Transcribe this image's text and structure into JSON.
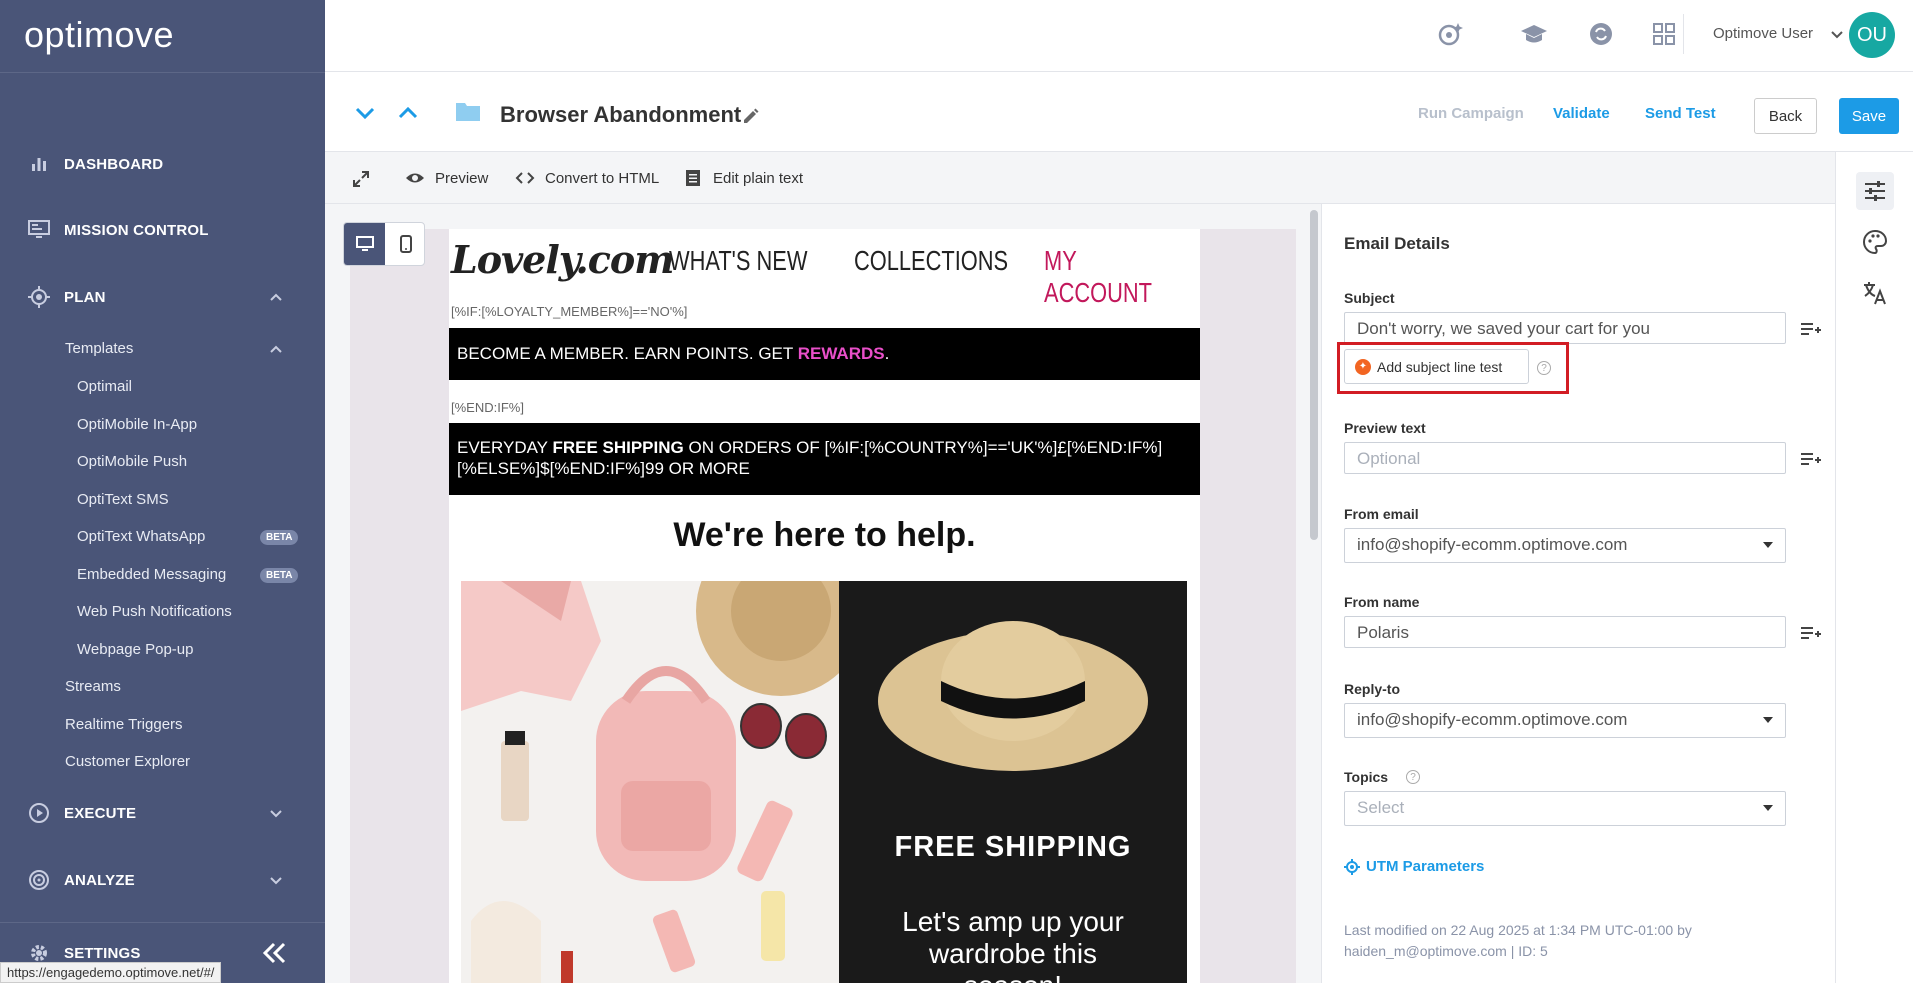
{
  "sidebar": {
    "logo": "optimove",
    "sections": {
      "dashboard": "DASHBOARD",
      "mission_control": "MISSION CONTROL",
      "plan": "PLAN",
      "execute": "EXECUTE",
      "analyze": "ANALYZE",
      "settings": "SETTINGS"
    },
    "plan_items": {
      "templates": "Templates",
      "optimail": "Optimail",
      "optimobile_inapp": "OptiMobile In-App",
      "optimobile_push": "OptiMobile Push",
      "optitext_sms": "OptiText SMS",
      "optitext_whatsapp": "OptiText WhatsApp",
      "embedded_messaging": "Embedded Messaging",
      "web_push": "Web Push Notifications",
      "webpage_popup": "Webpage Pop-up",
      "streams": "Streams",
      "realtime_triggers": "Realtime Triggers",
      "customer_explorer": "Customer Explorer"
    },
    "beta_badge": "BETA"
  },
  "status_url": "https://engagedemo.optimove.net/#/",
  "topbar": {
    "username": "Optimove User",
    "avatar_initials": "OU"
  },
  "campaign": {
    "title": "Browser Abandonment",
    "run_campaign": "Run Campaign",
    "validate": "Validate",
    "send_test": "Send Test",
    "back": "Back",
    "save": "Save"
  },
  "toolbar": {
    "preview": "Preview",
    "convert": "Convert to HTML",
    "edit_plain": "Edit plain text"
  },
  "email": {
    "brand": "Lovely.com",
    "nav": [
      "WHAT'S NEW",
      "COLLECTIONS",
      "MY ACCOUNT"
    ],
    "nav_accent": "#c2185b",
    "if_tag": "[%IF:[%LOYALTY_MEMBER%]=='NO'%]",
    "member_text": "BECOME A MEMBER. EARN POINTS. GET ",
    "member_rewards": "REWARDS",
    "member_end": ".",
    "end_tag": "[%END:IF%]",
    "ship_line1_a": "EVERYDAY ",
    "ship_line1_b": "FREE SHIPPING",
    "ship_line1_c": " ON ORDERS OF [%IF:[%COUNTRY%]=='UK'%]£[%END:IF%]",
    "ship_line2": "[%ELSE%]$[%END:IF%]99 OR MORE",
    "help_title": "We're here to help.",
    "free_shipping": "FREE SHIPPING",
    "amp_text_1": "Let's amp up your",
    "amp_text_2": "wardrobe this",
    "amp_text_3": "season!"
  },
  "panel": {
    "title": "Email Details",
    "subject_label": "Subject",
    "subject_value": "Don't worry, we saved your cart for you",
    "add_subject_test": "Add subject line test",
    "preview_label": "Preview text",
    "preview_placeholder": "Optional",
    "from_email_label": "From email",
    "from_email_value": "info@shopify-ecomm.optimove.com",
    "from_name_label": "From name",
    "from_name_value": "Polaris",
    "reply_to_label": "Reply-to",
    "reply_to_value": "info@shopify-ecomm.optimove.com",
    "topics_label": "Topics",
    "topics_placeholder": "Select",
    "utm": "UTM Parameters",
    "modified_1": "Last modified on 22 Aug 2025 at 1:34 PM UTC-01:00 by",
    "modified_2": "haiden_m@optimove.com | ID: 5"
  },
  "colors": {
    "sidebar_bg": "#4a5578",
    "accent_blue": "#1c9be6",
    "avatar": "#17a8a2",
    "highlight_box": "#d21d24"
  }
}
